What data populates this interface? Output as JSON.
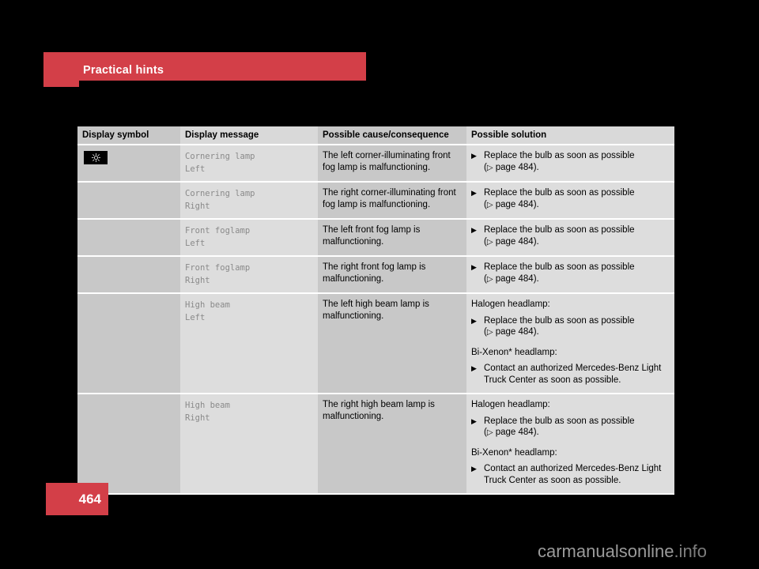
{
  "section": {
    "title": "Practical hints",
    "accent_color": "#d33f48"
  },
  "page": {
    "number": "464",
    "badge_color": "#d33f48"
  },
  "watermark": {
    "text": "carmanualsonline",
    "suffix": ".info"
  },
  "table": {
    "headers": {
      "symbol": "Display symbol",
      "message": "Display message",
      "cause": "Possible cause/consequence",
      "solution": "Possible solution"
    },
    "rows": [
      {
        "symbol_icon": "fog-lamp-icon",
        "has_symbol": true,
        "message": "Cornering lamp\nLeft",
        "cause": "The left corner-illuminating front fog lamp is malfunctioning.",
        "solution_blocks": [
          {
            "heading": "",
            "bullets": [
              {
                "mark": "▶",
                "text": "Replace the bulb as soon as possible",
                "ref_open": "(",
                "ref_arrow": "▷",
                "ref_text": " page 484).",
                "has_ref": true
              }
            ]
          }
        ]
      },
      {
        "has_symbol": false,
        "message": "Cornering lamp\nRight",
        "cause": "The right corner-illuminating front fog lamp is malfunctioning.",
        "solution_blocks": [
          {
            "heading": "",
            "bullets": [
              {
                "mark": "▶",
                "text": "Replace the bulb as soon as possible",
                "ref_open": "(",
                "ref_arrow": "▷",
                "ref_text": " page 484).",
                "has_ref": true
              }
            ]
          }
        ]
      },
      {
        "has_symbol": false,
        "message": "Front foglamp\nLeft",
        "cause": "The left front fog lamp is malfunctioning.",
        "solution_blocks": [
          {
            "heading": "",
            "bullets": [
              {
                "mark": "▶",
                "text": "Replace the bulb as soon as possible",
                "ref_open": "(",
                "ref_arrow": "▷",
                "ref_text": " page 484).",
                "has_ref": true
              }
            ]
          }
        ]
      },
      {
        "has_symbol": false,
        "message": "Front foglamp\nRight",
        "cause": "The right front fog lamp is malfunctioning.",
        "solution_blocks": [
          {
            "heading": "",
            "bullets": [
              {
                "mark": "▶",
                "text": "Replace the bulb as soon as possible",
                "ref_open": "(",
                "ref_arrow": "▷",
                "ref_text": " page 484).",
                "has_ref": true
              }
            ]
          }
        ]
      },
      {
        "has_symbol": false,
        "message": "High beam\nLeft",
        "cause": "The left high beam lamp is malfunctioning.",
        "solution_blocks": [
          {
            "heading": "Halogen headlamp:",
            "bullets": [
              {
                "mark": "▶",
                "text": "Replace the bulb as soon as possible",
                "ref_open": "(",
                "ref_arrow": "▷",
                "ref_text": " page 484).",
                "has_ref": true
              }
            ]
          },
          {
            "heading": "Bi-Xenon* headlamp:",
            "bullets": [
              {
                "mark": "▶",
                "text": "Contact an authorized Mercedes-Benz Light Truck Center as soon as possible.",
                "has_ref": false
              }
            ]
          }
        ]
      },
      {
        "has_symbol": false,
        "message": "High beam\nRight",
        "cause": "The right high beam lamp is malfunctioning.",
        "solution_blocks": [
          {
            "heading": "Halogen headlamp:",
            "bullets": [
              {
                "mark": "▶",
                "text": "Replace the bulb as soon as possible",
                "ref_open": "(",
                "ref_arrow": "▷",
                "ref_text": " page 484).",
                "has_ref": true
              }
            ]
          },
          {
            "heading": "Bi-Xenon* headlamp:",
            "bullets": [
              {
                "mark": "▶",
                "text": "Contact an authorized Mercedes-Benz Light Truck Center as soon as possible.",
                "has_ref": false
              }
            ]
          }
        ]
      }
    ]
  }
}
